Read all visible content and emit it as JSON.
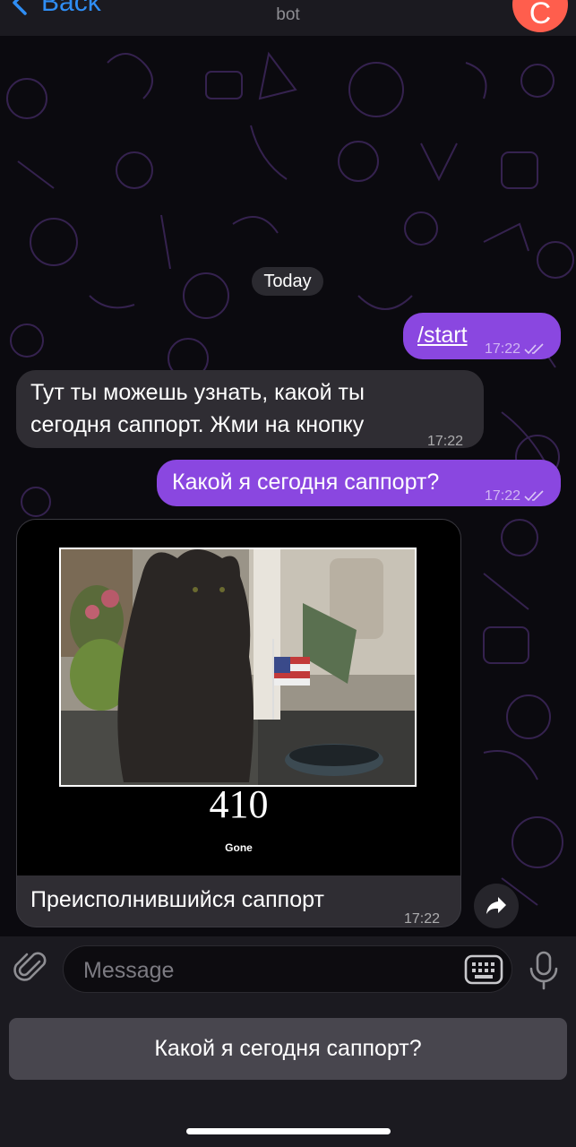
{
  "header": {
    "back_label": "Back",
    "subtitle": "bot",
    "avatar_letter": "С"
  },
  "chat": {
    "date_chip": "Today",
    "messages": [
      {
        "text": "/start",
        "time": "17:22",
        "outgoing": true
      },
      {
        "text": "Тут ты можешь узнать, какой ты сегодня саппорт. Жми на кнопку",
        "time": "17:22",
        "outgoing": false
      },
      {
        "text": "Какой я сегодня саппорт?",
        "time": "17:22",
        "outgoing": true
      },
      {
        "image_number": "410",
        "image_subtitle": "Gone",
        "caption": "Преисполнившийся саппорт",
        "time": "17:22",
        "outgoing": false
      }
    ]
  },
  "input": {
    "placeholder": "Message"
  },
  "reply_keyboard": {
    "button_label": "Какой я сегодня саппорт?"
  },
  "colors": {
    "outgoing_bubble": "#8a47e0",
    "incoming_bubble": "#2f2d33",
    "accent": "#2f8ef5",
    "avatar": "#ff5e4d"
  },
  "icons": [
    "chevron-left-icon",
    "double-check-icon",
    "forward-icon",
    "paperclip-icon",
    "keyboard-icon",
    "microphone-icon"
  ]
}
